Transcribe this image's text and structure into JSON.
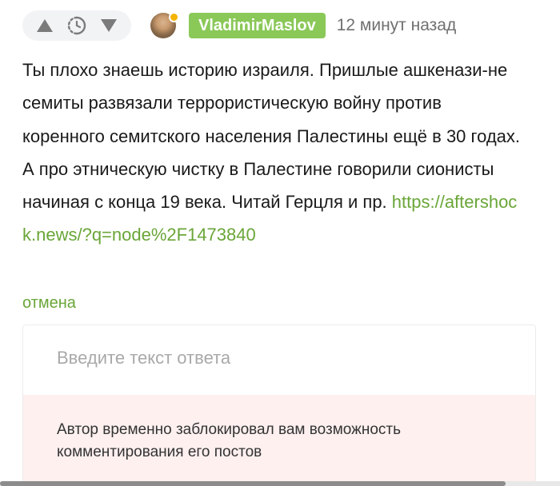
{
  "header": {
    "upvote_icon": "triangle-up-icon",
    "rating_icon": "dashed-clock-icon",
    "downvote_icon": "triangle-down-icon",
    "username": "VladimirMaslov",
    "timestamp": "12 минут назад",
    "username_bg": "#8ac858",
    "online_dot_color": "#f4b400"
  },
  "comment": {
    "text": "Ты плохо знаешь историю израиля. Пришлые ашкенази-не семиты развязали террористическую войну против коренного семитского населения Палестины ещё в 30 годах. А про этническую чистку в Палестине говорили сионисты начиная с конца 19 века. Читай Герцля и пр. ",
    "link": "https://aftershock.news/?q=node%2F1473840",
    "link_color": "#6aa638"
  },
  "cancel_label": "отмена",
  "reply": {
    "placeholder": "Введите текст ответа",
    "blocked_notice": "Автор временно заблокировал вам возможность комментирования его постов",
    "notice_bg": "#fdf0ef"
  }
}
